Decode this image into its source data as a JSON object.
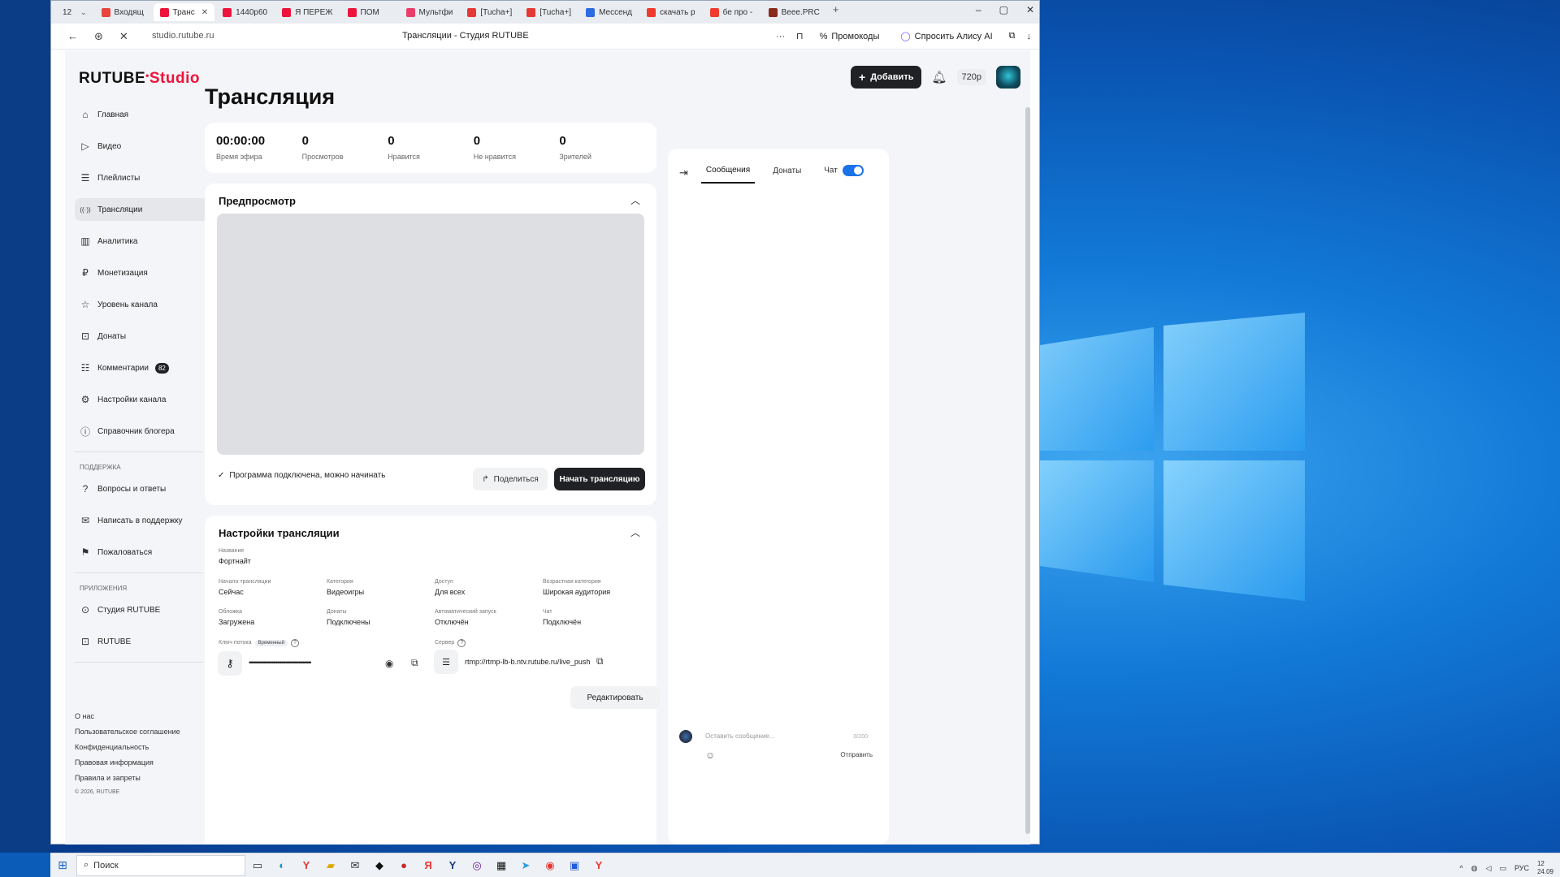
{
  "browser": {
    "tab_count": "12",
    "tabs": [
      {
        "label": "Входящ",
        "color": "#e8453c"
      },
      {
        "label": "Транс",
        "color": "#ed143b",
        "active": true
      },
      {
        "label": "1440p60",
        "color": "#ed143b"
      },
      {
        "label": "Я ПЕРЕЖ",
        "color": "#ed143b"
      },
      {
        "label": "ПОМ",
        "color": "#ed143b"
      },
      {
        "label": "Мультфи",
        "color": "#e83e6c"
      },
      {
        "label": "[Tucha+]",
        "color": "#e53935"
      },
      {
        "label": "[Tucha+]",
        "color": "#e53935"
      },
      {
        "label": "Мессенд",
        "color": "#2d6be0"
      },
      {
        "label": "скачать р",
        "color": "#ef3b2d"
      },
      {
        "label": "бе про -",
        "color": "#ef3b2d"
      },
      {
        "label": "Beee.PRC",
        "color": "#8b2a1c"
      }
    ],
    "url": "studio.rutube.ru",
    "page_title": "Трансляции - Студия RUTUBE",
    "promo_label": "Промокоды",
    "alice_label": "Спросить Алису AI"
  },
  "header": {
    "logo_main": "RUTUBE",
    "logo_accent": "Studio",
    "add_label": "Добавить",
    "quality": "720p"
  },
  "sidebar": {
    "items": [
      {
        "label": "Главная",
        "icon": "home-icon"
      },
      {
        "label": "Видео",
        "icon": "video-icon"
      },
      {
        "label": "Плейлисты",
        "icon": "playlist-icon"
      },
      {
        "label": "Трансляции",
        "icon": "broadcast-icon",
        "active": true
      },
      {
        "label": "Аналитика",
        "icon": "analytics-icon"
      },
      {
        "label": "Монетизация",
        "icon": "monetization-icon"
      },
      {
        "label": "Уровень канала",
        "icon": "star-icon"
      },
      {
        "label": "Донаты",
        "icon": "donate-icon"
      },
      {
        "label": "Комментарии",
        "icon": "comments-icon",
        "badge": "82"
      },
      {
        "label": "Настройки канала",
        "icon": "gear-icon"
      },
      {
        "label": "Справочник блогера",
        "icon": "info-icon"
      }
    ],
    "support_title": "ПОДДЕРЖКА",
    "support_items": [
      {
        "label": "Вопросы и ответы",
        "icon": "question-icon"
      },
      {
        "label": "Написать в поддержку",
        "icon": "mail-icon"
      },
      {
        "label": "Пожаловаться",
        "icon": "flag-icon"
      }
    ],
    "apps_title": "ПРИЛОЖЕНИЯ",
    "apps_items": [
      {
        "label": "Студия RUTUBE",
        "icon": "studio-app-icon"
      },
      {
        "label": "RUTUBE",
        "icon": "rutube-app-icon"
      }
    ],
    "footer_links": [
      "О нас",
      "Пользовательское соглашение",
      "Конфиденциальность",
      "Правовая информация",
      "Правила и запреты"
    ],
    "copyright": "© 2026, RUTUBE"
  },
  "main": {
    "title": "Трансляция",
    "stats": [
      {
        "value": "00:00:00",
        "label": "Время эфира"
      },
      {
        "value": "0",
        "label": "Просмотров"
      },
      {
        "value": "0",
        "label": "Нравится"
      },
      {
        "value": "0",
        "label": "Не нравится"
      },
      {
        "value": "0",
        "label": "Зрителей"
      }
    ],
    "preview": {
      "title": "Предпросмотр",
      "status": "Программа подключена, можно начинать",
      "share_label": "Поделиться",
      "start_label": "Начать трансляцию"
    },
    "settings": {
      "title": "Настройки трансляции",
      "name_label": "Название",
      "name_value": "Фортнайт",
      "start_label": "Начало трансляции",
      "start_value": "Сейчас",
      "category_label": "Категория",
      "category_value": "Видеоигры",
      "access_label": "Доступ",
      "access_value": "Для всех",
      "age_label": "Возрастная категория",
      "age_value": "Широкая аудитория",
      "cover_label": "Обложка",
      "cover_value": "Загружена",
      "donates_label": "Донаты",
      "donates_value": "Подключены",
      "autostart_label": "Автоматический запуск",
      "autostart_value": "Отключён",
      "chat_label": "Чат",
      "chat_value": "Подключён",
      "key_label": "Ключ потока",
      "key_tag": "Временный",
      "key_masked": "••••••••••••••••••••••••••••••••••••••••••••••",
      "server_label": "Сервер",
      "server_value": "rtmp://rtmp-lb-b.ntv.rutube.ru/live_push",
      "edit_label": "Редактировать"
    }
  },
  "chat": {
    "tab_messages": "Сообщения",
    "tab_donates": "Донаты",
    "chat_label": "Чат",
    "input_placeholder": "Оставить сообщение...",
    "counter": "0/200",
    "send_label": "Отправить"
  },
  "taskbar": {
    "search_label": "Поиск",
    "lang": "РУС",
    "time": "12",
    "date": "24.09"
  }
}
